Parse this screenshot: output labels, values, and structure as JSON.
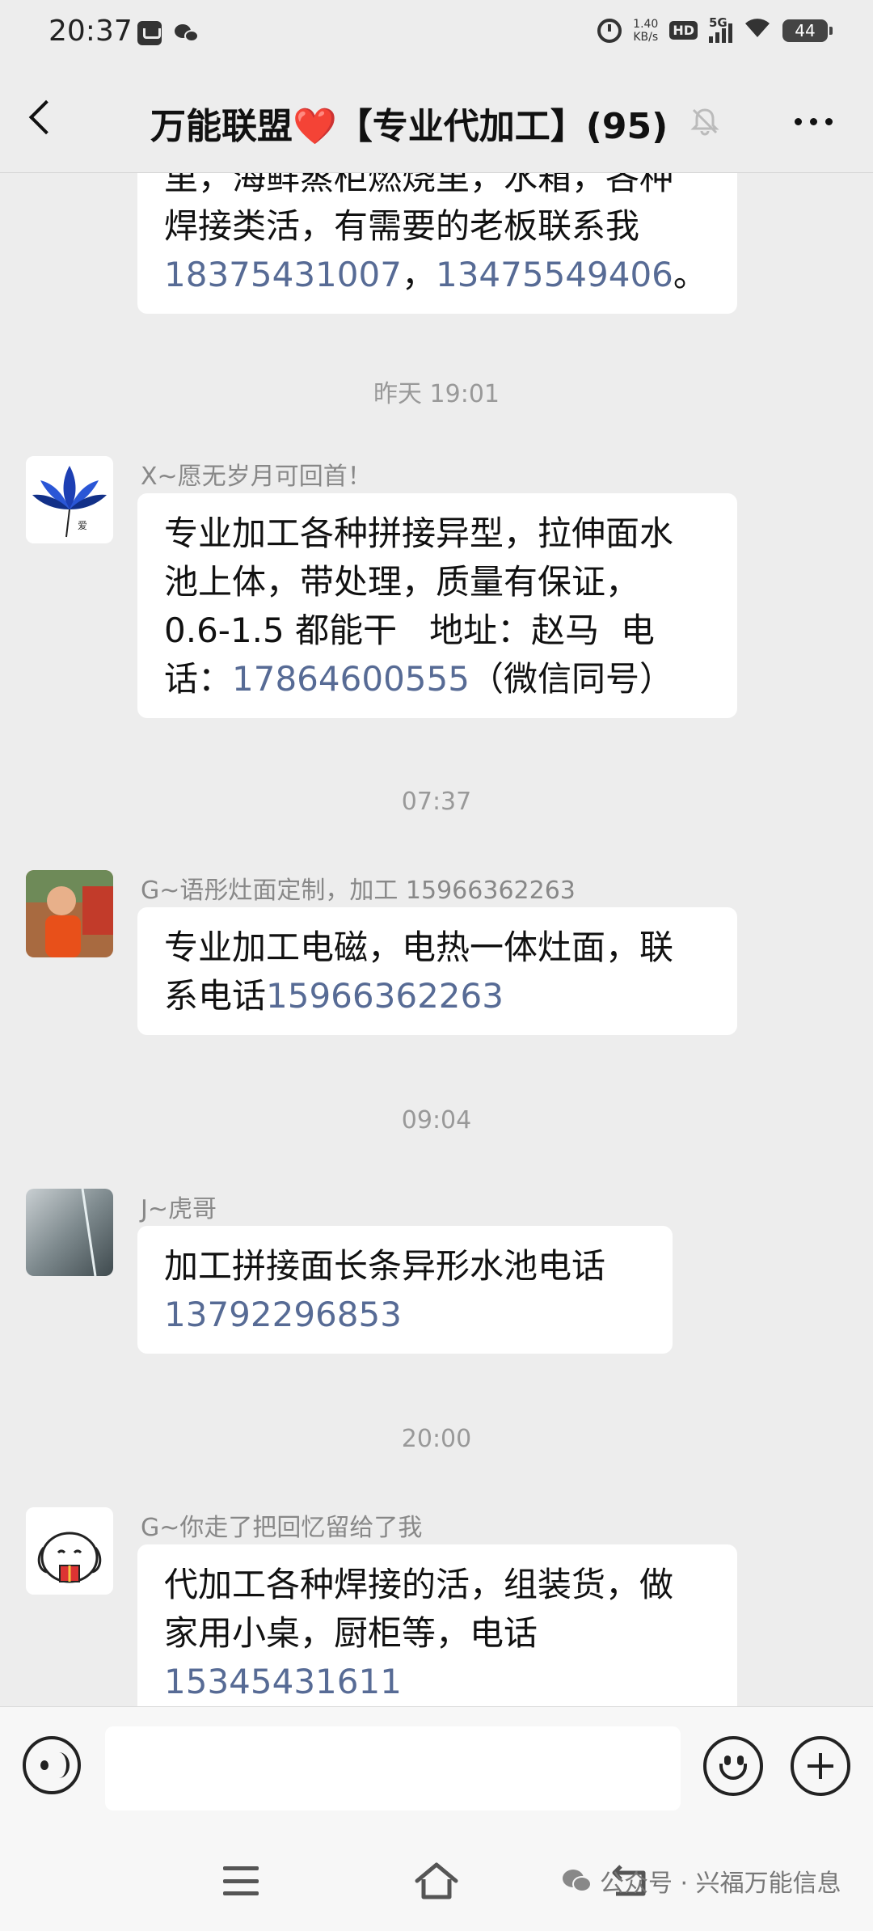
{
  "status_bar": {
    "time": "20:37",
    "net_speed_value": "1.40",
    "net_speed_unit": "KB/s",
    "hd": "HD",
    "network": "5G",
    "battery": "44"
  },
  "header": {
    "title_prefix": "万能联盟",
    "title_heart": "❤️",
    "title_suffix": "【专业代加工】(95)"
  },
  "messages": [
    {
      "line1": "焊接类活，有需要的老板联系我",
      "phone1": "18375431007",
      "sep": "，",
      "phone2": "13475549406",
      "end": "。",
      "clipped_text": "里，海鲜蒸柜燃烧里，水箱，各种"
    },
    {
      "timestamp": "昨天 19:01",
      "sender": "X~愿无岁月可回首！",
      "line1": "专业加工各种拼接异型，拉伸面水",
      "line2": "池上体，带处理，质量有保证，",
      "line3": "0.6-1.5 都能干   地址：赵马  电",
      "line4_pre": "话：",
      "phone": "17864600555",
      "line4_post": "（微信同号）"
    },
    {
      "timestamp": "07:37",
      "sender": "G~语彤灶面定制，加工  15966362263",
      "line1": "专业加工电磁，电热一体灶面，联",
      "line2_pre": "系电话",
      "phone": "15966362263"
    },
    {
      "timestamp": "09:04",
      "sender": "J~虎哥",
      "line1": "加工拼接面长条异形水池电话",
      "phone": "13792296853"
    },
    {
      "timestamp": "20:00",
      "sender": "G~你走了把回忆留给了我",
      "line1": "代加工各种焊接的活，组装货，做",
      "line2": "家用小桌，厨柜等，电话",
      "phone": "15345431611"
    }
  ],
  "watermark": "公众号 · 兴福万能信息",
  "colors": {
    "background": "#ededed",
    "bubble": "#ffffff",
    "link": "#576b95",
    "heart": "#e5262d"
  }
}
